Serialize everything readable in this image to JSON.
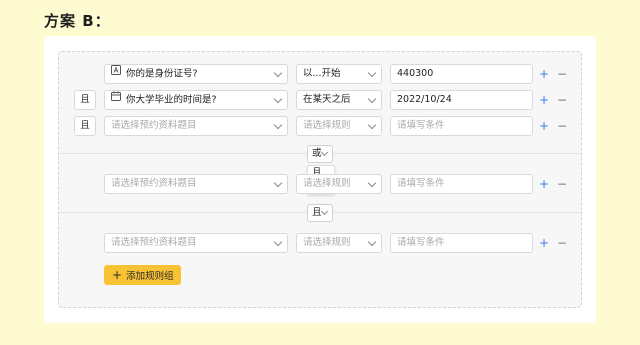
{
  "page_title": "方案 B：",
  "rules": [
    {
      "join": "",
      "field": "你的是身份证号?",
      "field_icon": "id-card-icon",
      "rule": "以...开始",
      "value": "440300"
    },
    {
      "join": "且",
      "field": "你大学毕业的时间是?",
      "field_icon": "calendar-icon",
      "rule": "在某天之后",
      "value": "2022/10/24"
    },
    {
      "join": "且",
      "field": "",
      "rule": "",
      "value": ""
    }
  ],
  "placeholders": {
    "field": "请选择预约资料题目",
    "rule": "请选择规则",
    "value": "请填写条件"
  },
  "group_logic": [
    {
      "selected": "或",
      "dropdown_open": true,
      "options": [
        "且",
        "或"
      ],
      "highlighted": "或"
    },
    {
      "selected": "且",
      "dropdown_open": false
    }
  ],
  "row_actions": {
    "add": "+",
    "remove": "−"
  },
  "add_group_button": {
    "icon": "+",
    "label": "添加规则组"
  },
  "colors": {
    "page_background": "#fffbd0",
    "accent_yellow": "#f7c233",
    "plus_blue": "#3b7cf0",
    "option_highlight": "#fff0b8"
  }
}
